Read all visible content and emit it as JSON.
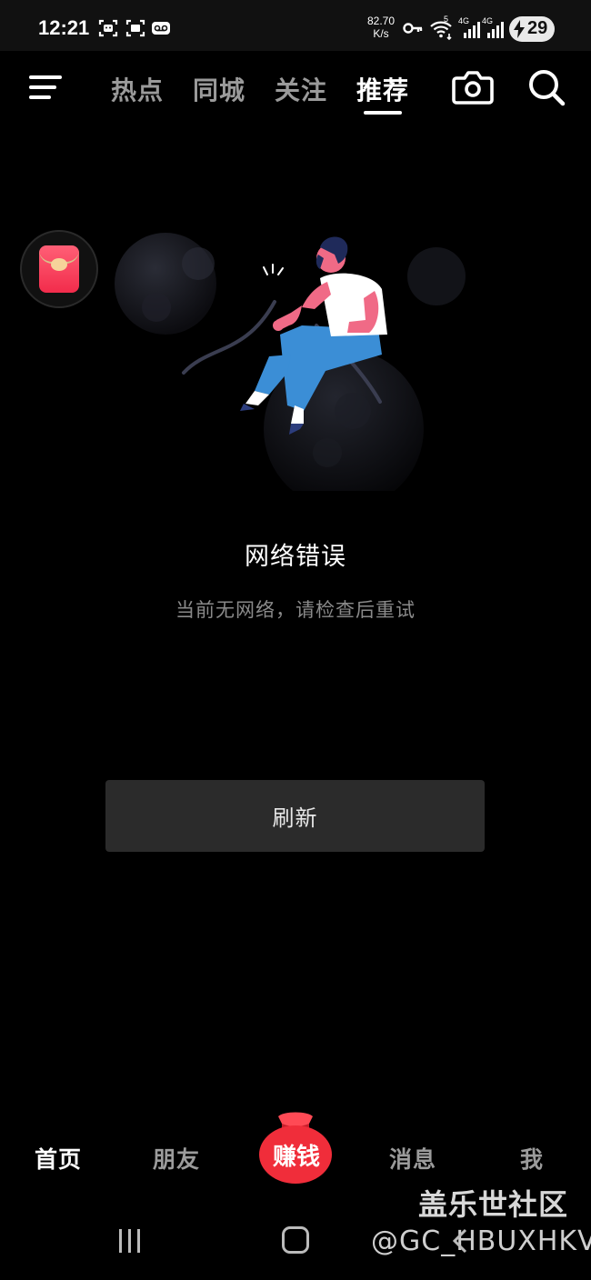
{
  "status_bar": {
    "time": "12:21",
    "speed_value": "82.70",
    "speed_unit": "K/s",
    "net1_label": "4G",
    "net2_label": "4G",
    "wifi_label": "5",
    "battery_level": "29",
    "icons": [
      "face-scan-icon",
      "scan-icon",
      "voicemail-icon",
      "key-icon",
      "wifi-icon",
      "signal-icon",
      "battery-charging-icon"
    ]
  },
  "top_nav": {
    "tabs": [
      {
        "label": "热点",
        "active": false
      },
      {
        "label": "同城",
        "active": false
      },
      {
        "label": "关注",
        "active": false
      },
      {
        "label": "推荐",
        "active": true
      }
    ]
  },
  "main": {
    "error_title": "网络错误",
    "error_subtitle": "当前无网络，请检查后重试",
    "refresh_label": "刷新"
  },
  "bottom_nav": {
    "tabs": [
      {
        "label": "首页",
        "active": true
      },
      {
        "label": "朋友",
        "active": false
      },
      {
        "label": "赚钱",
        "active": false
      },
      {
        "label": "消息",
        "active": false
      },
      {
        "label": "我",
        "active": false
      }
    ]
  },
  "watermark": {
    "line1": "盖乐世社区",
    "line2": "@GC_HBUXHKV"
  },
  "colors": {
    "background": "#000000",
    "accent_red": "#f02d3a",
    "tab_inactive": "#9a9a9a",
    "button_bg": "#2b2b2b"
  }
}
